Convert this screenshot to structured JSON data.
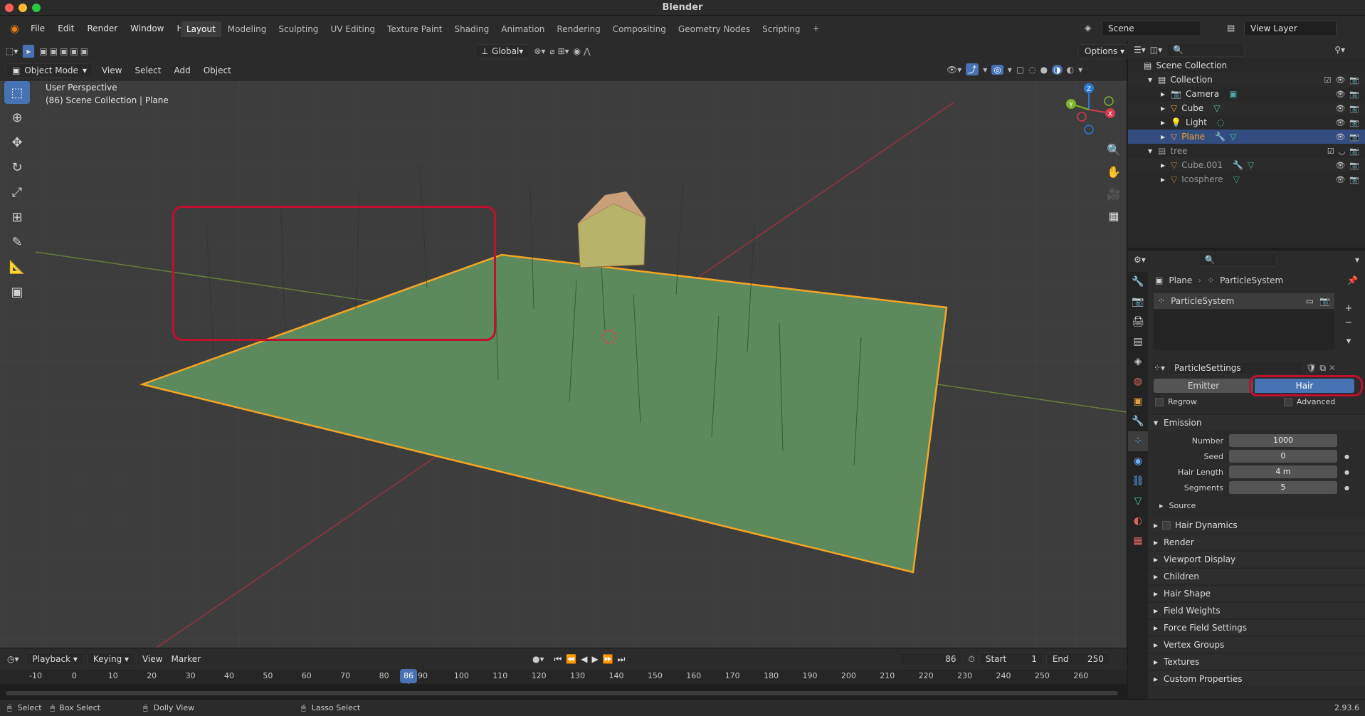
{
  "window": {
    "title": "Blender"
  },
  "menu": [
    "File",
    "Edit",
    "Render",
    "Window",
    "Help"
  ],
  "workspace_tabs": [
    "Layout",
    "Modeling",
    "Sculpting",
    "UV Editing",
    "Texture Paint",
    "Shading",
    "Animation",
    "Rendering",
    "Compositing",
    "Geometry Nodes",
    "Scripting"
  ],
  "active_tab": "Layout",
  "scene": {
    "scene_name": "Scene",
    "view_layer": "View Layer"
  },
  "viewport_header": {
    "mode": "Object Mode",
    "menus": [
      "View",
      "Select",
      "Add",
      "Object"
    ],
    "transform": "Global",
    "options": "Options"
  },
  "viewport": {
    "line1": "User Perspective",
    "line2": "(86) Scene Collection | Plane",
    "axes": [
      "X",
      "Y",
      "Z"
    ]
  },
  "outliner": {
    "root": "Scene Collection",
    "rows": [
      {
        "label": "Collection"
      },
      {
        "label": "Camera"
      },
      {
        "label": "Cube"
      },
      {
        "label": "Light"
      },
      {
        "label": "Plane"
      },
      {
        "label": "tree"
      },
      {
        "label": "Cube.001"
      },
      {
        "label": "Icosphere"
      }
    ]
  },
  "properties": {
    "breadcrumb_object": "Plane",
    "breadcrumb_system": "ParticleSystem",
    "system_list_item": "ParticleSystem",
    "settings_name": "ParticleSettings",
    "type_emitter": "Emitter",
    "type_hair": "Hair",
    "regrow": "Regrow",
    "advanced": "Advanced",
    "emission_title": "Emission",
    "fields": [
      {
        "label": "Number",
        "value": "1000"
      },
      {
        "label": "Seed",
        "value": "0"
      },
      {
        "label": "Hair Length",
        "value": "4 m"
      },
      {
        "label": "Segments",
        "value": "5"
      }
    ],
    "source": "Source",
    "panels": [
      "Hair Dynamics",
      "Render",
      "Viewport Display",
      "Children",
      "Hair Shape",
      "Field Weights",
      "Force Field Settings",
      "Vertex Groups",
      "Textures",
      "Custom Properties"
    ]
  },
  "timeline": {
    "menus": [
      "Playback",
      "Keying",
      "View",
      "Marker"
    ],
    "current_frame": "86",
    "start_label": "Start",
    "start": "1",
    "end_label": "End",
    "end": "250",
    "ticks": [
      "-10",
      "0",
      "10",
      "20",
      "30",
      "40",
      "50",
      "60",
      "70",
      "80",
      "90",
      "100",
      "110",
      "120",
      "130",
      "140",
      "150",
      "160",
      "170",
      "180",
      "190",
      "200",
      "210",
      "220",
      "230",
      "240",
      "250",
      "260"
    ]
  },
  "statusbar": {
    "select": "Select",
    "box_select": "Box Select",
    "dolly": "Dolly View",
    "lasso": "Lasso Select",
    "version": "2.93.6"
  },
  "colors": {
    "accent": "#4772b3",
    "selection": "#f5a623",
    "highlight": "#c0102e",
    "ground": "#5d8a5d"
  }
}
